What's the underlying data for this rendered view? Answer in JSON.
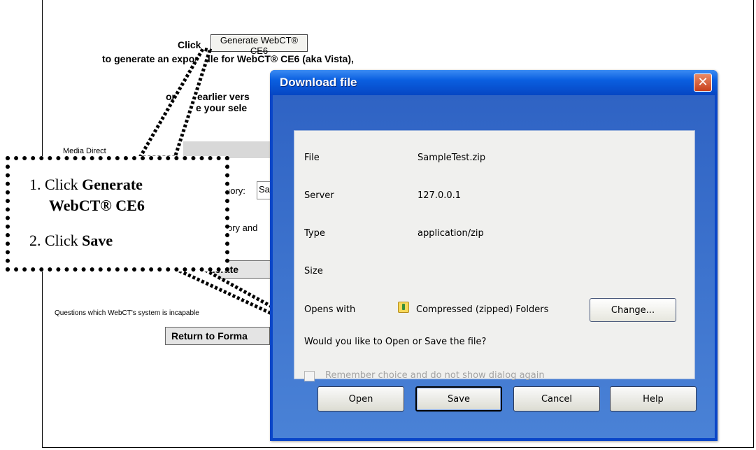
{
  "background": {
    "click_label": "Click",
    "generate_button": "Generate WebCT® CE6",
    "line2": "to generate an export file for WebCT® CE6 (aka Vista),",
    "line3a": "or",
    "line3b": "earlier vers",
    "line4": "e your sele",
    "media_label": "Media Direct",
    "category_label": "gory:",
    "category_value": "Sa",
    "category_line2": "ory and",
    "generate_button_2": "nerate",
    "questions_text": "Questions which WebCT's system is incapable",
    "return_button": "Return to Forma"
  },
  "callout": {
    "step1_prefix": "1. Click ",
    "step1_bold_a": "Generate",
    "step1_bold_b": "WebCT® CE6",
    "step2_prefix": "2. Click ",
    "step2_bold": "Save"
  },
  "dialog": {
    "title": "Download file",
    "close_glyph": "✕",
    "fields": {
      "file_label": "File",
      "file_value": "SampleTest.zip",
      "server_label": "Server",
      "server_value": "127.0.0.1",
      "type_label": "Type",
      "type_value": "application/zip",
      "size_label": "Size",
      "opens_label": "Opens with",
      "opens_value": "Compressed (zipped) Folders"
    },
    "change_button": "Change...",
    "question": "Would you like to Open or Save the file?",
    "remember_checkbox": "Remember choice and do not show dialog again",
    "buttons": {
      "open": "Open",
      "save": "Save",
      "cancel": "Cancel",
      "help": "Help"
    }
  },
  "colors": {
    "title_bar": "#0a5fe0",
    "close_button": "#d9572d",
    "dialog_panel": "#f0f0ee"
  }
}
